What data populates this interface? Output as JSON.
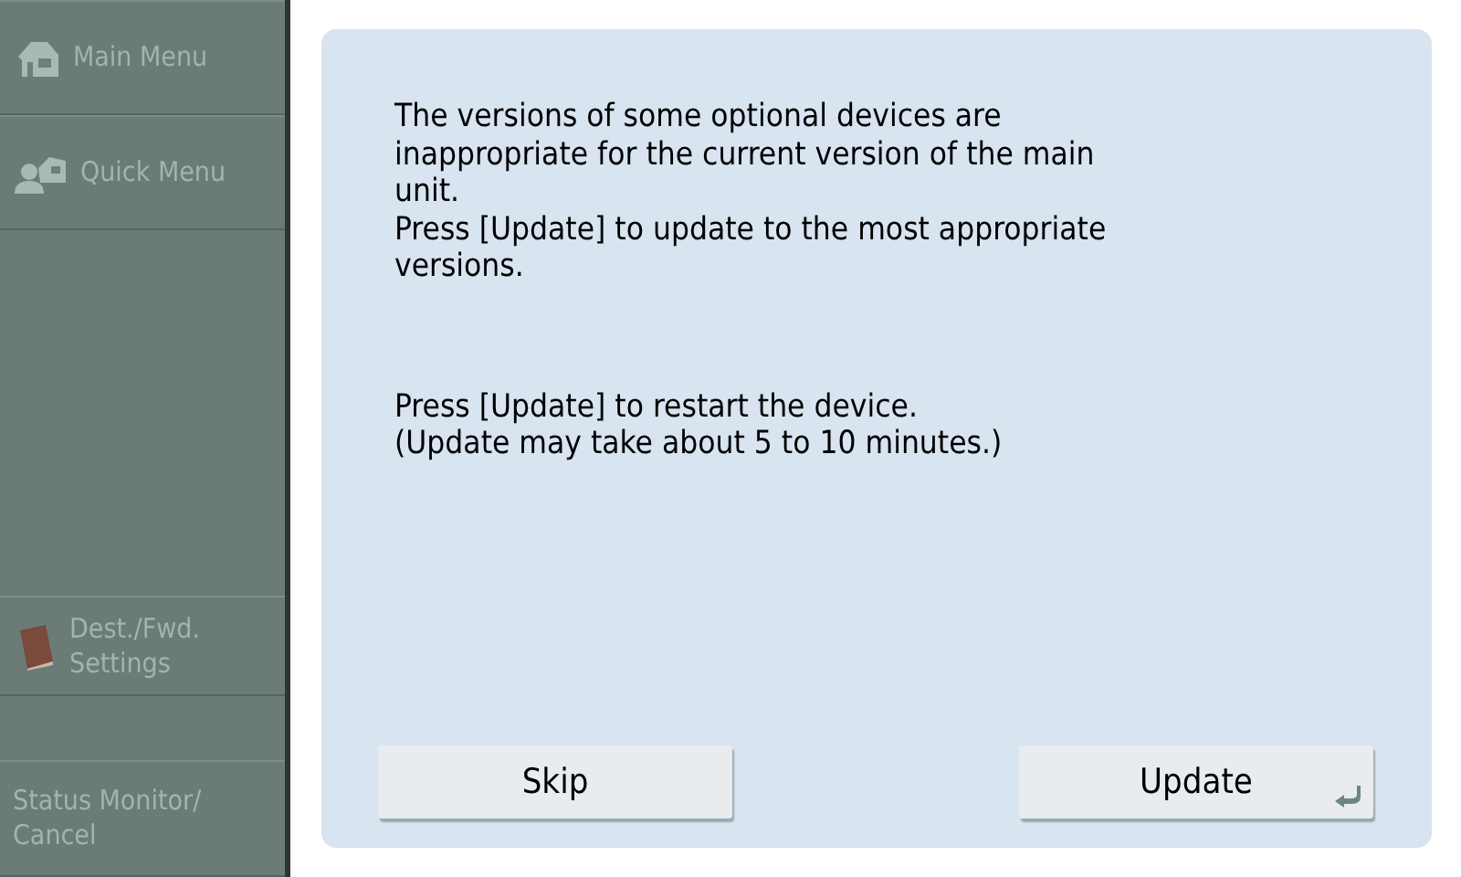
{
  "sidebar": {
    "items": [
      {
        "kind": "home",
        "label": "Main Menu",
        "disabled": true
      },
      {
        "kind": "quick",
        "label": "Quick Menu",
        "disabled": true
      },
      {
        "kind": "book",
        "label": "Dest./Fwd.\nSettings",
        "disabled": true
      },
      {
        "kind": "plain",
        "label": "Status Monitor/\nCancel",
        "disabled": true
      }
    ]
  },
  "dialog": {
    "paragraphs": [
      "The versions of some optional devices are\ninappropriate for the current version of the main\nunit.\nPress [Update] to update to the most appropriate\nversions.",
      "Press [Update] to restart the device.\n(Update may take about 5 to 10 minutes.)"
    ],
    "buttons": [
      {
        "label": "Skip",
        "default": false
      },
      {
        "label": "Update",
        "default": true
      }
    ]
  }
}
